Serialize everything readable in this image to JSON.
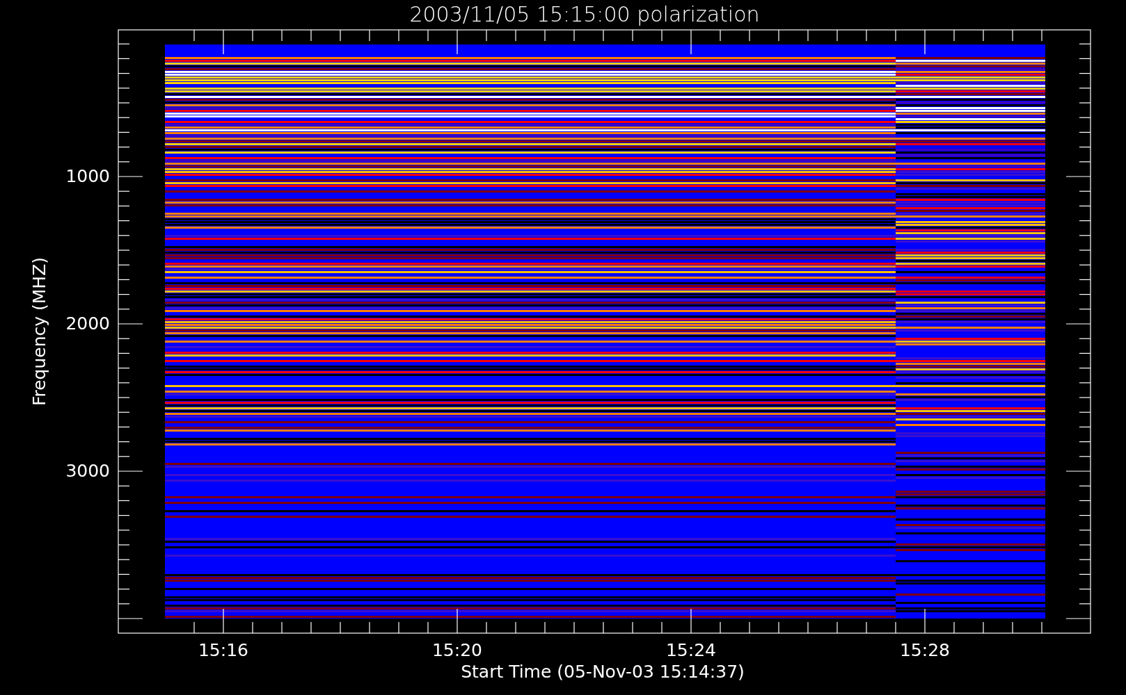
{
  "title": "2003/11/05 15:15:00 polarization",
  "ylabel": "Frequency (MHZ)",
  "xlabel": "Start Time (05-Nov-03 15:14:37)",
  "yticks": [
    "1000",
    "2000",
    "3000"
  ],
  "xticks": [
    "15:16",
    "15:20",
    "15:24",
    "15:28"
  ]
}
